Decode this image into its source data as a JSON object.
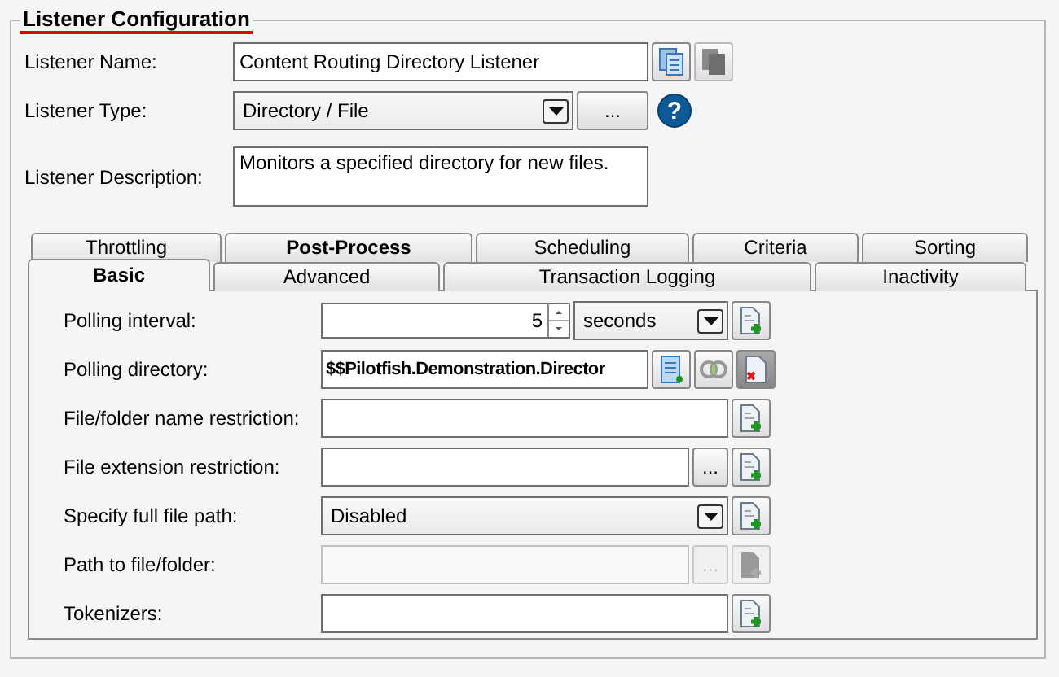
{
  "group": {
    "title": "Listener Configuration"
  },
  "listener": {
    "name_label": "Listener Name:",
    "name": "Content Routing Directory Listener",
    "type_label": "Listener Type:",
    "type": "Directory / File",
    "type_button": "...",
    "help_icon": "?",
    "description_label": "Listener Description:",
    "description": "Monitors a specified directory for new files."
  },
  "tab_rows": [
    [
      {
        "label": "Throttling",
        "selected": false,
        "bold": false
      },
      {
        "label": "Post-Process",
        "selected": false,
        "bold": true
      },
      {
        "label": "Scheduling",
        "selected": false,
        "bold": false
      },
      {
        "label": "Criteria",
        "selected": false,
        "bold": false
      },
      {
        "label": "Sorting",
        "selected": false,
        "bold": false
      }
    ],
    [
      {
        "label": "Basic",
        "selected": true,
        "bold": true
      },
      {
        "label": "Advanced",
        "selected": false,
        "bold": false
      },
      {
        "label": "Transaction Logging",
        "selected": false,
        "bold": false
      },
      {
        "label": "Inactivity",
        "selected": false,
        "bold": false
      }
    ]
  ],
  "fields": [
    {
      "kind": "spinner",
      "label": "Polling interval:",
      "value": "5",
      "unit": "seconds",
      "disabled": false
    },
    {
      "kind": "directory",
      "label": "Polling directory:",
      "value": "$$Pilotfish.Demonstration.Director",
      "disabled": false
    },
    {
      "kind": "text",
      "label": "File/folder name restriction:",
      "disabled": false
    },
    {
      "kind": "browse",
      "label": "File extension restriction:",
      "button": "...",
      "disabled": false
    },
    {
      "kind": "select",
      "label": "Specify full file path:",
      "value": "Disabled",
      "disabled": false
    },
    {
      "kind": "browse",
      "label": "Path to file/folder:",
      "button": "...",
      "disabled": true
    },
    {
      "kind": "text",
      "label": "Tokenizers:",
      "disabled": false
    }
  ]
}
